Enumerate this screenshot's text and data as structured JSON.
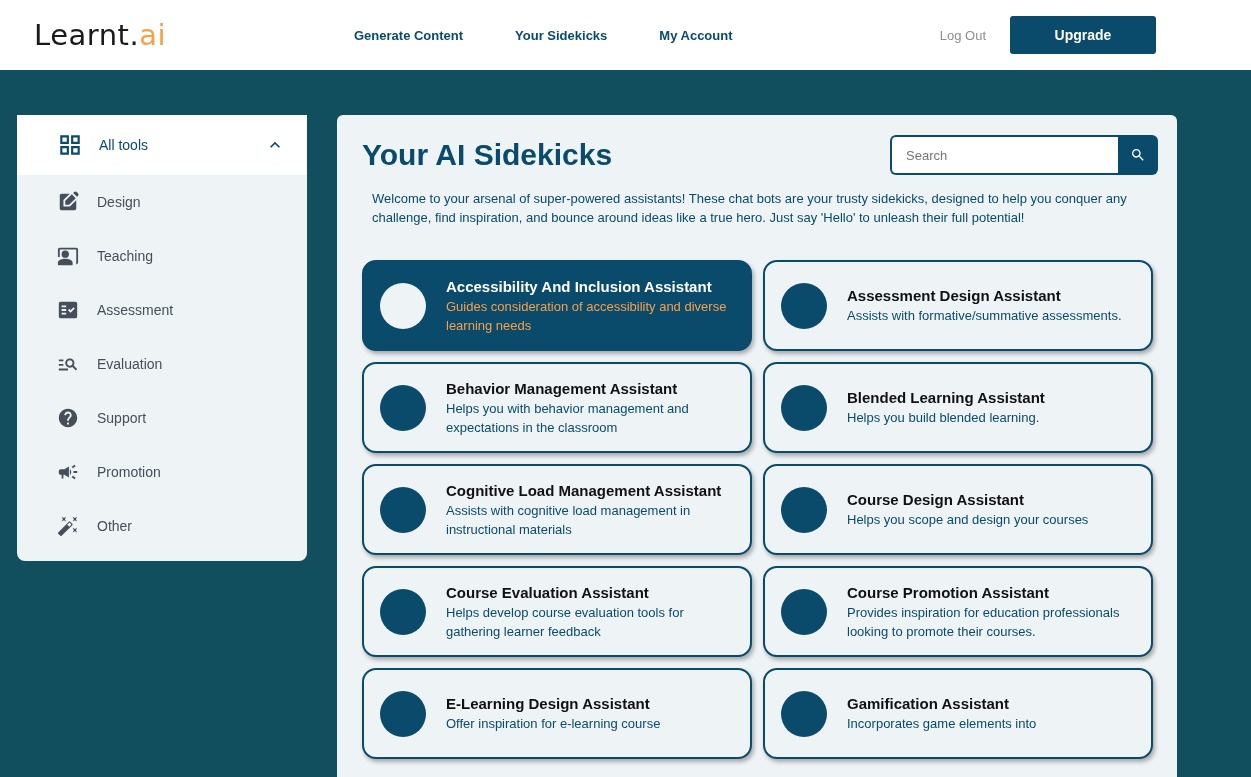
{
  "header": {
    "logo": {
      "main": "Learnt.",
      "accent": "ai"
    },
    "nav": [
      {
        "label": "Generate Content"
      },
      {
        "label": "Your Sidekicks"
      },
      {
        "label": "My Account"
      }
    ],
    "logout": "Log Out",
    "upgrade": "Upgrade"
  },
  "sidebar": {
    "header": {
      "label": "All tools",
      "expanded": true
    },
    "items": [
      {
        "label": "Design"
      },
      {
        "label": "Teaching"
      },
      {
        "label": "Assessment"
      },
      {
        "label": "Evaluation"
      },
      {
        "label": "Support"
      },
      {
        "label": "Promotion"
      },
      {
        "label": "Other"
      }
    ]
  },
  "main": {
    "title": "Your AI Sidekicks",
    "search": {
      "placeholder": "Search"
    },
    "intro": "Welcome to your arsenal of super-powered assistants! These chat bots are your trusty sidekicks, designed to help you conquer any challenge, find inspiration, and bounce around ideas like a true hero. Just say 'Hello' to unleash their full potential!",
    "cards": [
      {
        "title": "Accessibility And Inclusion Assistant",
        "description": "Guides consideration of accessibility and diverse learning needs",
        "selected": true
      },
      {
        "title": "Assessment Design Assistant",
        "description": "Assists with formative/summative assessments.",
        "selected": false
      },
      {
        "title": "Behavior Management Assistant",
        "description": "Helps you with behavior management and expectations in the classroom",
        "selected": false
      },
      {
        "title": "Blended Learning Assistant",
        "description": "Helps you build blended learning.",
        "selected": false
      },
      {
        "title": "Cognitive Load Management Assistant",
        "description": "Assists with cognitive load management in instructional materials",
        "selected": false
      },
      {
        "title": "Course Design Assistant",
        "description": "Helps you scope and design your courses",
        "selected": false
      },
      {
        "title": "Course Evaluation Assistant",
        "description": "Helps develop course evaluation tools for gathering learner feedback",
        "selected": false
      },
      {
        "title": "Course Promotion Assistant",
        "description": "Provides inspiration for education professionals looking to promote their courses.",
        "selected": false
      },
      {
        "title": "E-Learning Design Assistant",
        "description": "Offer inspiration for e-learning course",
        "selected": false
      },
      {
        "title": "Gamification Assistant",
        "description": "Incorporates game elements into",
        "selected": false
      }
    ]
  }
}
